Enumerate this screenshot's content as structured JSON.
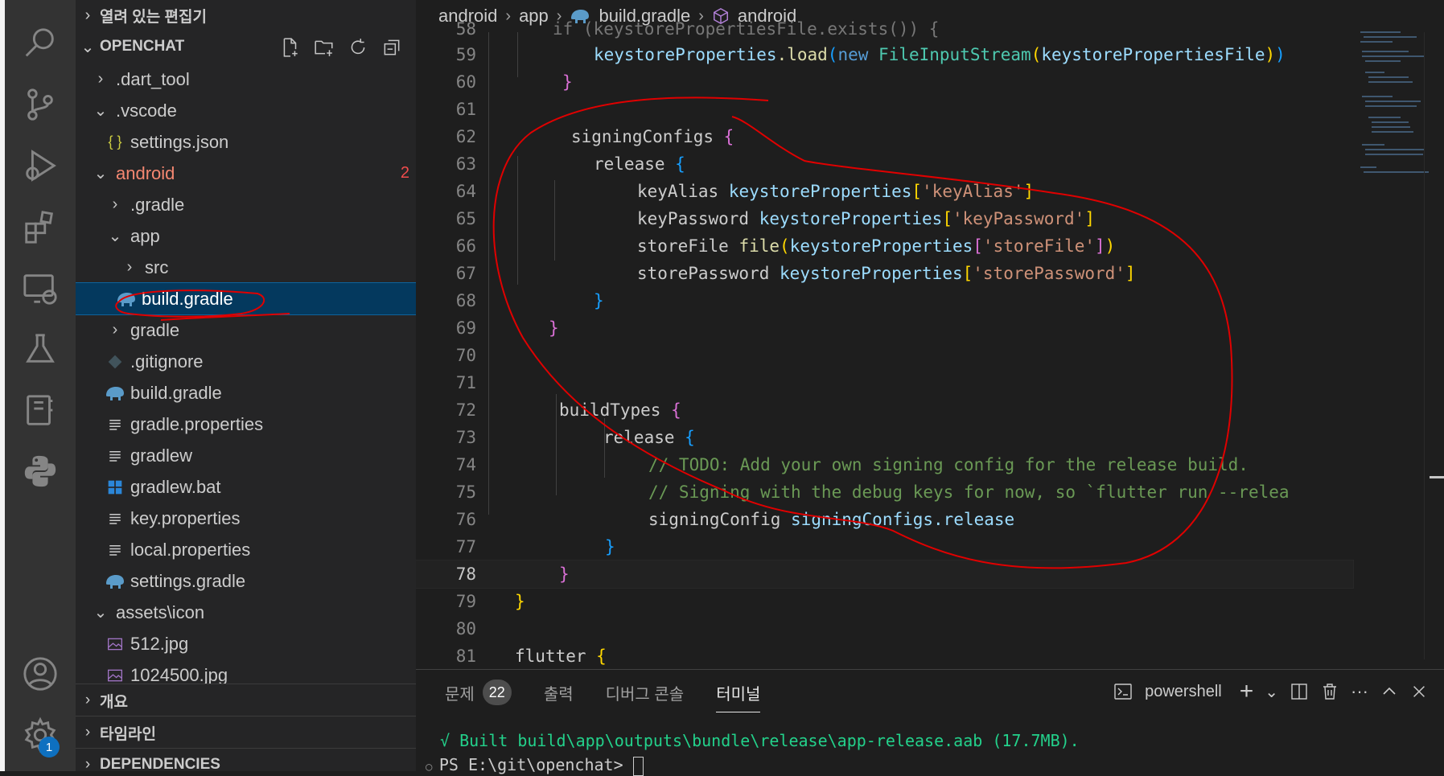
{
  "explorer": {
    "open_editors": "열려 있는 편집기",
    "project": "OPENCHAT",
    "tree": [
      {
        "label": ".dart_tool",
        "chev": "›",
        "icon": ""
      },
      {
        "label": ".vscode",
        "chev": "⌄",
        "icon": ""
      },
      {
        "label": "settings.json",
        "chev": "",
        "icon": "{ }"
      },
      {
        "label": "android",
        "chev": "⌄",
        "icon": "",
        "count": "2"
      },
      {
        "label": ".gradle",
        "chev": "›",
        "icon": ""
      },
      {
        "label": "app",
        "chev": "⌄",
        "icon": ""
      },
      {
        "label": "src",
        "chev": "›",
        "icon": ""
      },
      {
        "label": "build.gradle",
        "chev": "",
        "icon": "gradle"
      },
      {
        "label": "gradle",
        "chev": "›",
        "icon": ""
      },
      {
        "label": ".gitignore",
        "chev": "",
        "icon": "git"
      },
      {
        "label": "build.gradle",
        "chev": "",
        "icon": "gradle"
      },
      {
        "label": "gradle.properties",
        "chev": "",
        "icon": "lines"
      },
      {
        "label": "gradlew",
        "chev": "",
        "icon": "lines"
      },
      {
        "label": "gradlew.bat",
        "chev": "",
        "icon": "windows"
      },
      {
        "label": "key.properties",
        "chev": "",
        "icon": "lines"
      },
      {
        "label": "local.properties",
        "chev": "",
        "icon": "lines"
      },
      {
        "label": "settings.gradle",
        "chev": "",
        "icon": "gradle"
      },
      {
        "label": "assets\\icon",
        "chev": "⌄",
        "icon": ""
      },
      {
        "label": "512.jpg",
        "chev": "",
        "icon": "image"
      },
      {
        "label": "1024500.jpg",
        "chev": "",
        "icon": "image"
      }
    ],
    "outline": "개요",
    "timeline": "타임라인",
    "dependencies": "DEPENDENCIES"
  },
  "breadcrumb": {
    "p1": "android",
    "p2": "app",
    "p3": "build.gradle",
    "p4": "android"
  },
  "code": {
    "l58": "if (keystorePropertiesFile.exists()) {",
    "lines": [
      "58",
      "59",
      "60",
      "61",
      "62",
      "63",
      "64",
      "65",
      "66",
      "67",
      "68",
      "69",
      "70",
      "71",
      "72",
      "73",
      "74",
      "75",
      "76",
      "77",
      "78",
      "79",
      "80",
      "81"
    ],
    "t_load_obj": "keystoreProperties",
    "t_load_fn": ".load",
    "t_new": "new",
    "t_fis": "FileInputStream",
    "t_ksfile": "keystorePropertiesFile",
    "t_signingConfigs": "signingConfigs",
    "t_release": "release",
    "t_keyAlias": "keyAlias",
    "t_keyPassword": "keyPassword",
    "t_storeFile": "storeFile",
    "t_file": "file",
    "t_storePassword": "storePassword",
    "t_kp": "keystoreProperties",
    "s_keyAlias": "'keyAlias'",
    "s_keyPassword": "'keyPassword'",
    "s_storeFile": "'storeFile'",
    "s_storePassword": "'storePassword'",
    "t_buildTypes": "buildTypes",
    "c74": "// TODO: Add your own signing config for the release build.",
    "c75": "// Signing with the debug keys for now, so `flutter run --relea",
    "t_signingConfig": "signingConfig",
    "t_scr": "signingConfigs.release",
    "t_flutter": "flutter"
  },
  "panel": {
    "tab_problems": "문제",
    "problems_count": "22",
    "tab_output": "출력",
    "tab_debug": "디버그 콘솔",
    "tab_terminal": "터미널",
    "shell": "powershell",
    "term_line1": "√ Built build\\app\\outputs\\bundle\\release\\app-release.aab (17.7MB).",
    "term_prompt": "PS E:\\git\\openchat> "
  },
  "activity": {
    "accounts_badge": "1"
  },
  "colors": {
    "annotation": "#e00000",
    "accent": "#0e70c0"
  }
}
